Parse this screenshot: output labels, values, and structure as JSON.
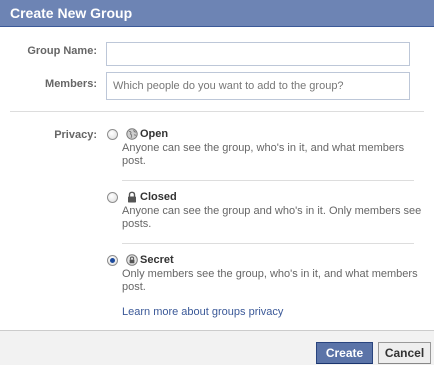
{
  "dialog": {
    "title": "Create New Group"
  },
  "form": {
    "group_name_label": "Group Name:",
    "group_name_value": "",
    "members_label": "Members:",
    "members_placeholder": "Which people do you want to add to the group?",
    "privacy_label": "Privacy:"
  },
  "privacy_options": [
    {
      "title": "Open",
      "icon": "globe-icon",
      "description": "Anyone can see the group, who's in it, and what members post.",
      "selected": false
    },
    {
      "title": "Closed",
      "icon": "lock-icon",
      "description": "Anyone can see the group and who's in it. Only members see posts.",
      "selected": false
    },
    {
      "title": "Secret",
      "icon": "lock-circle-icon",
      "description": "Only members see the group, who's in it, and what members post.",
      "selected": true
    }
  ],
  "links": {
    "learn_more": "Learn more about groups privacy"
  },
  "footer": {
    "create_label": "Create",
    "cancel_label": "Cancel"
  },
  "colors": {
    "titlebar": "#6d84b4",
    "primary_button": "#5b74a8",
    "link": "#3b5998"
  }
}
